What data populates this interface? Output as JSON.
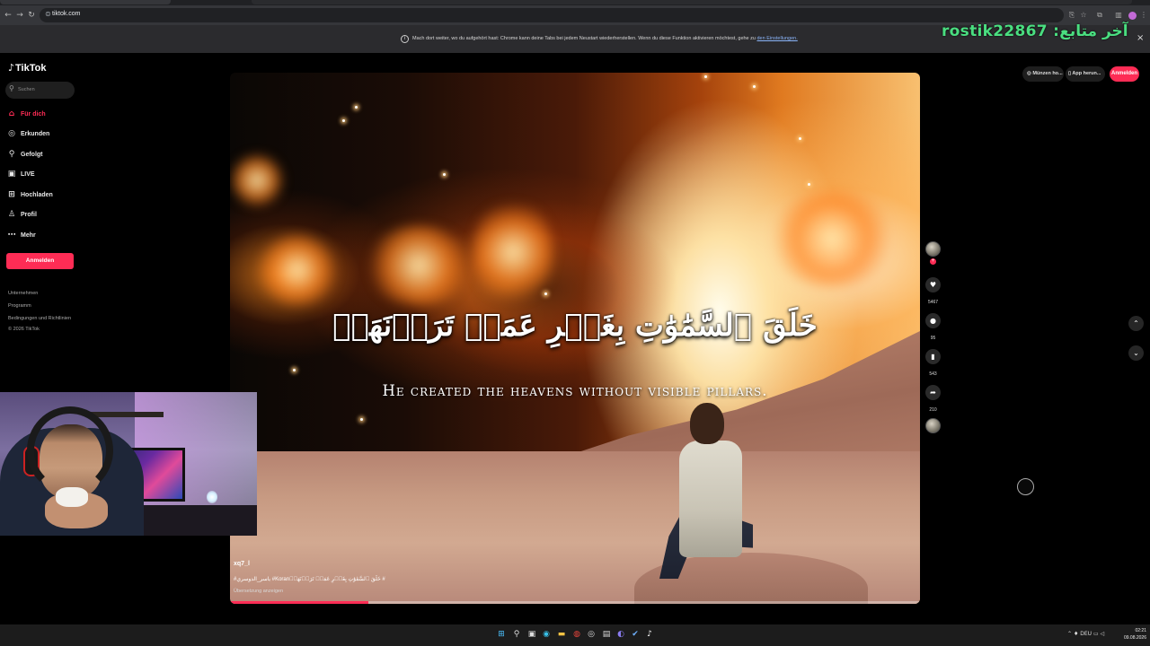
{
  "browser": {
    "url": "tiktok.com",
    "info_bar_text": "Mach dort weiter, wo du aufgehört hast: Chrome kann deine Tabs bei jedem Neustart wiederherstellen. Wenn du diese Funktion aktivieren möchtest, gehe zu",
    "info_bar_link": "den Einstellungen.",
    "info_close": "×",
    "icons": [
      "back-icon",
      "forward-icon",
      "reload-icon",
      "site-info-icon",
      "translate-icon",
      "bookmark-star-icon",
      "extensions-icon",
      "sidepanel-icon",
      "profile-icon",
      "menu-icon",
      "close-icon"
    ]
  },
  "stream_overlay": {
    "follower_text": "rostik22867 :آخر متابع"
  },
  "sidebar": {
    "logo": "TikTok",
    "search_placeholder": "Suchen",
    "items": [
      {
        "label": "Für dich",
        "icon": "home-icon",
        "glyph": "⌂",
        "active": true
      },
      {
        "label": "Erkunden",
        "icon": "compass-icon",
        "glyph": "◎",
        "active": false
      },
      {
        "label": "Gefolgt",
        "icon": "following-icon",
        "glyph": "⚲",
        "active": false
      },
      {
        "label": "LIVE",
        "icon": "live-icon",
        "glyph": "▣",
        "active": false
      },
      {
        "label": "Hochladen",
        "icon": "upload-icon",
        "glyph": "⊞",
        "active": false
      },
      {
        "label": "Profil",
        "icon": "profile-icon",
        "glyph": "♙",
        "active": false
      },
      {
        "label": "Mehr",
        "icon": "more-icon",
        "glyph": "⋯",
        "active": false
      }
    ],
    "login_label": "Anmelden",
    "footer_links": [
      "Unternehmen",
      "Programm",
      "Bedingungen und Richtlinien",
      "© 2026 TikTok"
    ]
  },
  "header_right": {
    "coins_label": "Münzen ho...",
    "app_label": "App herun...",
    "signin_label": "Anmelden"
  },
  "video": {
    "arabic_subtitle": "خَلَقَ ٱلسَّمَٰوَٰتِ بِغَيۡرِ عَمَدٖ تَرَوۡنَهَاۖ",
    "english_subtitle": "He created the heavens without visible pillars.",
    "username": "xq7_l",
    "caption": "#ياسر_الدوسري #Koranخَلَقَ ٱلسَّمَٰوَٰتِ بِغَيۡرِ عَمَدٖ تَرَوۡنَهَاۖ #",
    "translate_label": "Übersetzung anzeigen",
    "progress": 0.2
  },
  "actions": {
    "likes": "5467",
    "comments": "95",
    "saves": "543",
    "shares": "210"
  },
  "taskbar": {
    "language": "DEU",
    "time": "02:21",
    "date": "09.08.2026",
    "icons": [
      "windows-start-icon",
      "search-icon",
      "task-view-icon",
      "edge-icon",
      "file-explorer-icon",
      "chrome-icon",
      "obs-icon",
      "notepad-icon",
      "discord-icon",
      "steam-icon",
      "tiktok-icon"
    ]
  },
  "colors": {
    "tiktok_pink": "#fe2c55",
    "follower_green": "#4ade80",
    "background": "#000000"
  }
}
